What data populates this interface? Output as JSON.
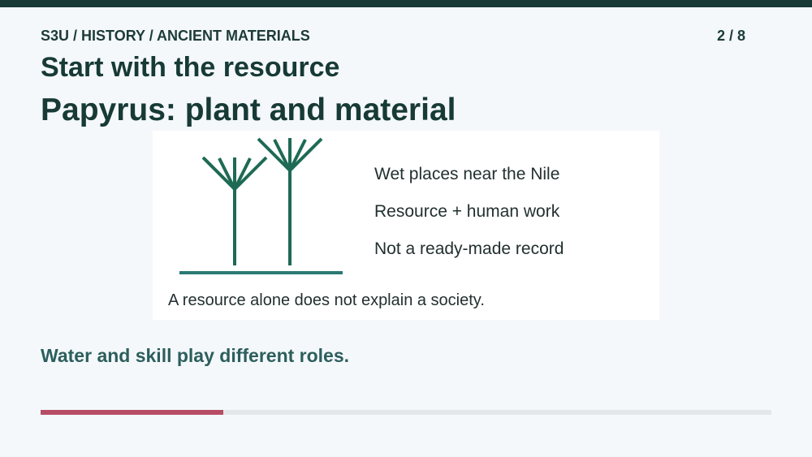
{
  "header": {
    "breadcrumb": "S3U / HISTORY / ANCIENT MATERIALS",
    "page_counter": "2 / 8"
  },
  "slide": {
    "title": "Start with the resource",
    "heading": "Papyrus: plant and material",
    "card": {
      "illustration_icon": "papyrus-plant-icon",
      "facts": [
        "Wet places near the Nile",
        "Resource + human work",
        "Not a ready-made record"
      ],
      "caption": "A resource alone does not explain a society."
    },
    "takeaway": "Water and skill play different roles."
  },
  "progress": {
    "fraction": 0.25
  },
  "colors": {
    "top_bar": "#173a36",
    "plant": "#1e6a55",
    "ground": "#2a7a74",
    "progress_fill": "#b64d65",
    "takeaway": "#2c5e5c"
  }
}
